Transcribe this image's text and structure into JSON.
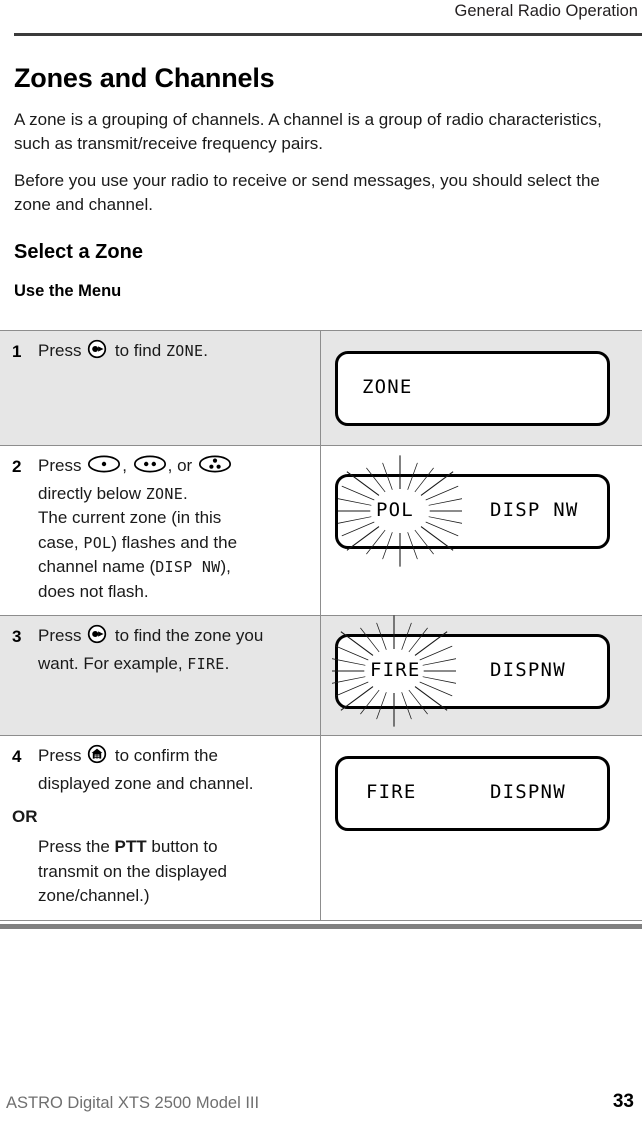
{
  "header": {
    "title": "General Radio Operation"
  },
  "main": {
    "chapter_title": "Zones and Channels",
    "paragraphs": [
      "A zone is a grouping of channels. A channel is a group of radio characteristics, such as transmit/receive frequency pairs.",
      "Before you use your radio to receive or send messages, you should select the zone and channel."
    ],
    "section_title": "Select a Zone",
    "subsection_title": "Use the Menu"
  },
  "procedure": {
    "rows": [
      {
        "number": "1",
        "icons": [
          "menu-select-key-icon"
        ],
        "lines": [
          {
            "segments": [
              {
                "text": "Press ",
                "style": "normal"
              },
              {
                "text": "KEY:menu-select",
                "style": "icon"
              },
              {
                "text": " to find ",
                "style": "normal"
              },
              {
                "text": "ZONE",
                "style": "mono"
              },
              {
                "text": ".",
                "style": "normal"
              }
            ]
          }
        ],
        "display": {
          "left_text": "ZONE",
          "right_text": "",
          "flash_left": false,
          "flash_right": false
        },
        "shaded": true
      },
      {
        "number": "2",
        "icons": [
          "one-dot-key-icon",
          "two-dot-key-icon",
          "three-dot-key-icon"
        ],
        "lines": [
          {
            "segments": [
              {
                "text": "Press ",
                "style": "normal"
              },
              {
                "text": "KEY:one-dot",
                "style": "icon"
              },
              {
                "text": ", ",
                "style": "normal"
              },
              {
                "text": "KEY:two-dot",
                "style": "icon"
              },
              {
                "text": ", or ",
                "style": "normal"
              },
              {
                "text": "KEY:three-dot",
                "style": "icon"
              }
            ]
          },
          {
            "segments": [
              {
                "text": "directly below ",
                "style": "normal"
              },
              {
                "text": "ZONE",
                "style": "mono"
              },
              {
                "text": ".",
                "style": "normal"
              }
            ]
          },
          {
            "segments": [
              {
                "text": "The current zone (in this",
                "style": "normal"
              }
            ]
          },
          {
            "segments": [
              {
                "text": "case, ",
                "style": "normal"
              },
              {
                "text": "POL",
                "style": "mono"
              },
              {
                "text": ") flashes and the",
                "style": "normal"
              }
            ]
          },
          {
            "segments": [
              {
                "text": "channel name (",
                "style": "normal"
              },
              {
                "text": "DISP NW",
                "style": "mono"
              },
              {
                "text": "),",
                "style": "normal"
              }
            ]
          },
          {
            "segments": [
              {
                "text": "does not flash.",
                "style": "normal"
              }
            ]
          }
        ],
        "display": {
          "left_text": "POL",
          "right_text": "DISP NW",
          "flash_left": true,
          "flash_right": false
        },
        "shaded": false
      },
      {
        "number": "3",
        "icons": [
          "menu-select-key-icon"
        ],
        "lines": [
          {
            "segments": [
              {
                "text": "Press ",
                "style": "normal"
              },
              {
                "text": "KEY:menu-select",
                "style": "icon"
              },
              {
                "text": " to find the zone you",
                "style": "normal"
              }
            ]
          },
          {
            "segments": [
              {
                "text": "want. For example, ",
                "style": "normal"
              },
              {
                "text": "FIRE",
                "style": "mono"
              },
              {
                "text": ".",
                "style": "normal"
              }
            ]
          }
        ],
        "display": {
          "left_text": "FIRE",
          "right_text": "DISPNW",
          "flash_left": true,
          "flash_right": false
        },
        "shaded": true
      },
      {
        "number": "4",
        "icons": [
          "home-key-icon"
        ],
        "lines": [
          {
            "segments": [
              {
                "text": "Press ",
                "style": "normal"
              },
              {
                "text": "KEY:home",
                "style": "icon"
              },
              {
                "text": " to confirm the",
                "style": "normal"
              }
            ]
          },
          {
            "segments": [
              {
                "text": "displayed zone and channel.",
                "style": "normal"
              }
            ]
          }
        ],
        "or_label": "OR",
        "alt_lines": [
          {
            "segments": [
              {
                "text": "Press the ",
                "style": "normal"
              },
              {
                "text": "PTT",
                "style": "bold"
              },
              {
                "text": " button to",
                "style": "normal"
              }
            ]
          },
          {
            "segments": [
              {
                "text": "transmit on the displayed",
                "style": "normal"
              }
            ]
          },
          {
            "segments": [
              {
                "text": "zone/channel.)",
                "style": "normal"
              }
            ]
          }
        ],
        "display": {
          "left_text": "FIRE",
          "right_text": "DISPNW",
          "flash_left": false,
          "flash_right": false
        },
        "shaded": false
      }
    ]
  },
  "footer": {
    "product": "ASTRO Digital XTS 2500  Model III",
    "page_number": "33"
  },
  "colors": {
    "shaded_row": "#e6e6e6",
    "rule": "#8d8d8d",
    "header_rule": "#3b3b3b",
    "bottom_bar": "#808080",
    "footer_text": "#6f6f6f"
  }
}
